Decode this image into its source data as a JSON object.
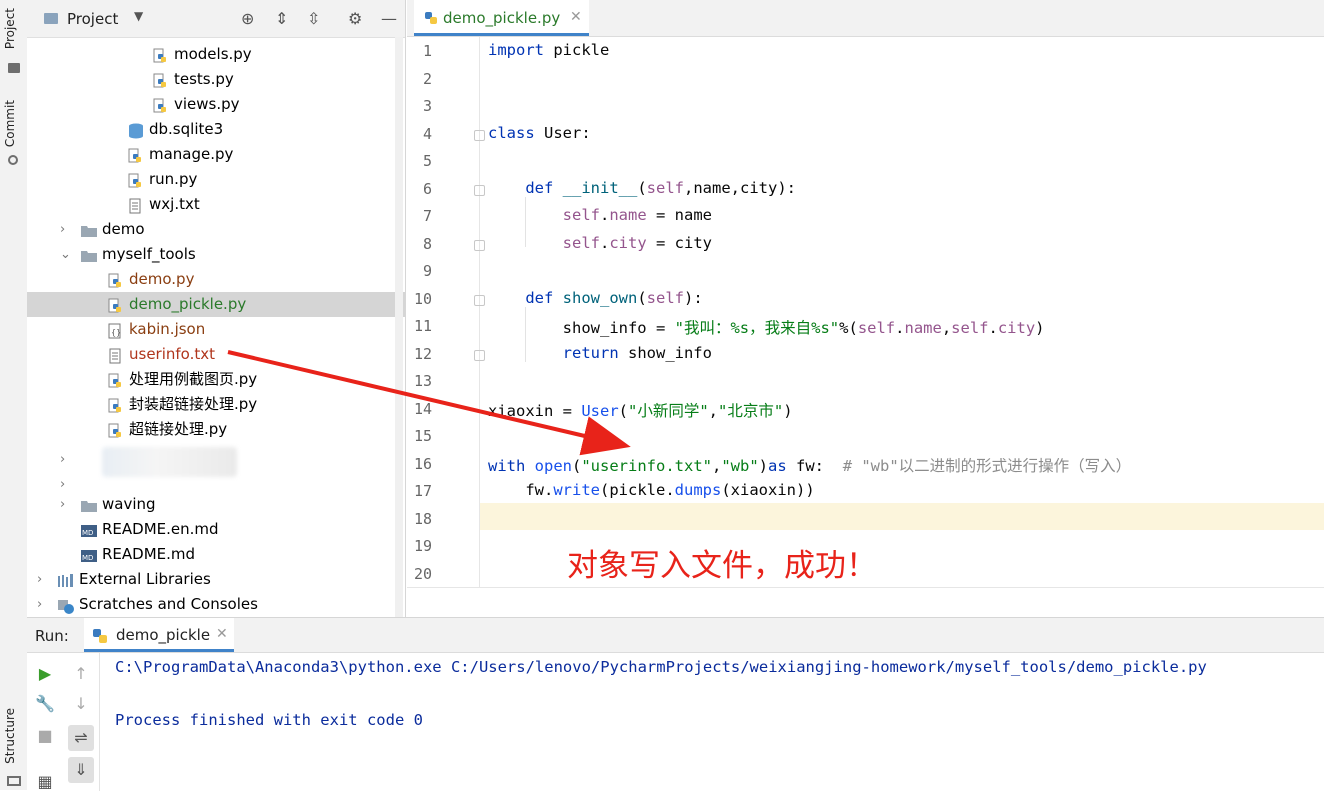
{
  "left_strip": {
    "project_tab": "Project",
    "commit_tab": "Commit",
    "structure_tab": "Structure"
  },
  "project_panel": {
    "title": "Project",
    "tree": [
      {
        "label": "models.py",
        "type": "python",
        "color": "#000000"
      },
      {
        "label": "tests.py",
        "type": "python",
        "color": "#000000"
      },
      {
        "label": "views.py",
        "type": "python",
        "color": "#000000"
      },
      {
        "label": "db.sqlite3",
        "type": "database",
        "color": "#000000"
      },
      {
        "label": "manage.py",
        "type": "python",
        "color": "#000000"
      },
      {
        "label": "run.py",
        "type": "python",
        "color": "#000000"
      },
      {
        "label": "wxj.txt",
        "type": "text",
        "color": "#000000"
      },
      {
        "label": "demo",
        "type": "folder",
        "color": "#000000"
      },
      {
        "label": "myself_tools",
        "type": "folder-open",
        "color": "#000000"
      },
      {
        "label": "demo.py",
        "type": "python",
        "color": "#8a3e11"
      },
      {
        "label": "demo_pickle.py",
        "type": "python",
        "color": "#2b7a2b"
      },
      {
        "label": "kabin.json",
        "type": "json",
        "color": "#8a3e11"
      },
      {
        "label": "userinfo.txt",
        "type": "text",
        "color": "#b0351c"
      },
      {
        "label": "处理用例截图页.py",
        "type": "python",
        "color": "#000000"
      },
      {
        "label": "封装超链接处理.py",
        "type": "python",
        "color": "#000000"
      },
      {
        "label": "超链接处理.py",
        "type": "python",
        "color": "#000000"
      },
      {
        "label": "waving",
        "type": "folder",
        "color": "#000000"
      },
      {
        "label": "README.en.md",
        "type": "markdown",
        "color": "#000000"
      },
      {
        "label": "README.md",
        "type": "markdown",
        "color": "#000000"
      },
      {
        "label": "External Libraries",
        "type": "library",
        "color": "#000000"
      },
      {
        "label": "Scratches and Consoles",
        "type": "scratch",
        "color": "#000000"
      }
    ]
  },
  "editor": {
    "tab_label": "demo_pickle.py",
    "line_numbers": [
      "1",
      "2",
      "3",
      "4",
      "5",
      "6",
      "7",
      "8",
      "9",
      "10",
      "11",
      "12",
      "13",
      "14",
      "15",
      "16",
      "17",
      "18",
      "19",
      "20"
    ]
  },
  "annotation": {
    "text": "对象写入文件，成功！",
    "color": "#e8231a"
  },
  "run_panel": {
    "label": "Run:",
    "tab_label": "demo_pickle",
    "console_lines": [
      "C:\\ProgramData\\Anaconda3\\python.exe C:/Users/lenovo/PycharmProjects/weixiangjing-homework/myself_tools/demo_pickle.py",
      "",
      "Process finished with exit code 0"
    ]
  }
}
